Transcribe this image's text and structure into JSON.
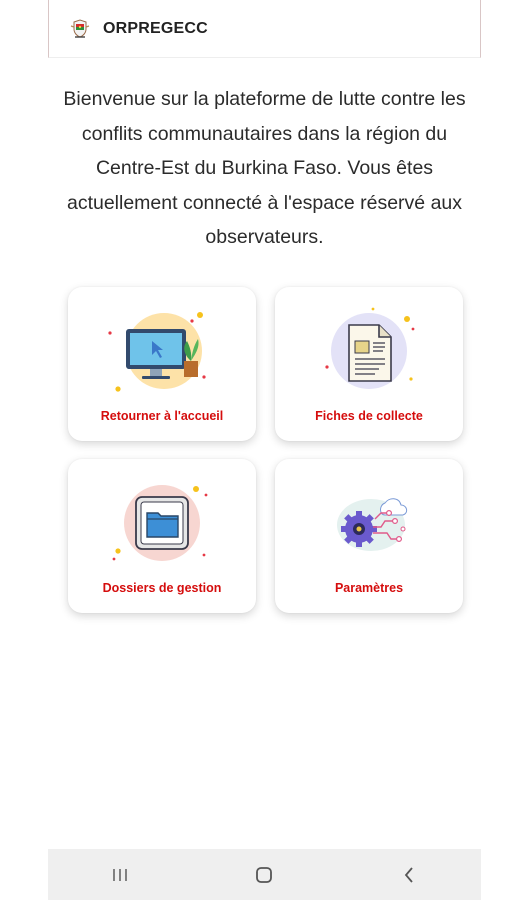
{
  "app": {
    "title": "ORPREGECC",
    "logo_icon": "coat-of-arms-icon"
  },
  "welcome": {
    "text": "Bienvenue sur la plateforme de lutte contre les conflits communautaires dans la région du Centre-Est du Burkina Faso. Vous êtes actuellement connecté à l'espace réservé aux observateurs."
  },
  "menu": {
    "items": [
      {
        "label": "Retourner à l'accueil",
        "icon": "computer-home-icon",
        "accent": "#fde2a8"
      },
      {
        "label": "Fiches de collecte",
        "icon": "document-form-icon",
        "accent": "#e3e2f7"
      },
      {
        "label": "Dossiers de gestion",
        "icon": "folder-icon",
        "accent": "#f7d6d1"
      },
      {
        "label": "Paramètres",
        "icon": "settings-gear-icon",
        "accent": "#e4f1ef"
      }
    ]
  },
  "colors": {
    "label_red": "#d50d0d",
    "text_dark": "#2b2b2b",
    "nav_bg": "#efefef"
  },
  "navigation": {
    "recents_icon": "recents-icon",
    "home_icon": "home-icon",
    "back_icon": "back-icon"
  }
}
